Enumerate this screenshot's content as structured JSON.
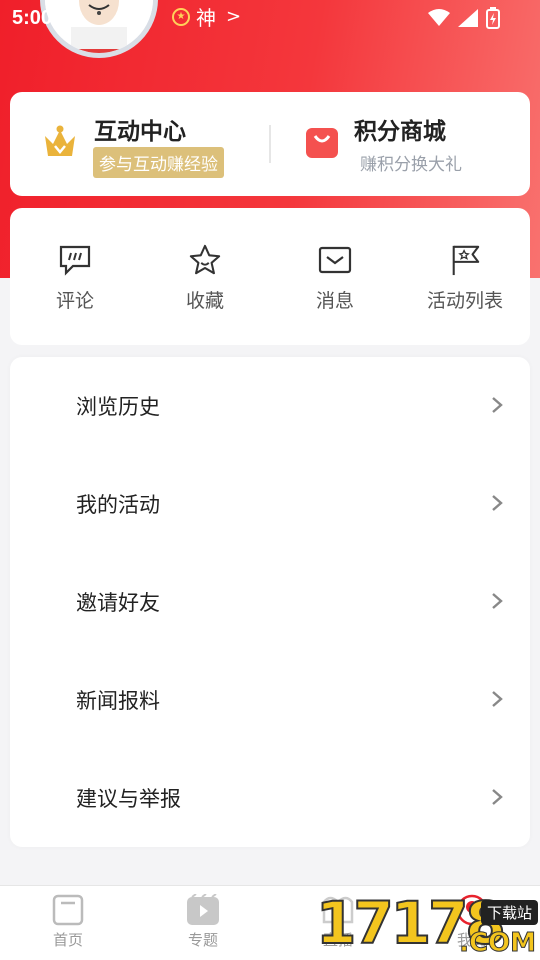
{
  "status_bar": {
    "time": "5:00"
  },
  "profile": {
    "level_label": "神"
  },
  "top_card": {
    "interaction": {
      "title": "互动中心",
      "badge": "参与互动赚经验"
    },
    "mall": {
      "title": "积分商城",
      "subtitle": "赚积分换大礼"
    }
  },
  "quick_actions": [
    {
      "label": "评论",
      "icon": "comment-icon"
    },
    {
      "label": "收藏",
      "icon": "star-icon"
    },
    {
      "label": "消息",
      "icon": "mail-icon"
    },
    {
      "label": "活动列表",
      "icon": "flag-icon"
    }
  ],
  "menu": [
    {
      "label": "浏览历史"
    },
    {
      "label": "我的活动"
    },
    {
      "label": "邀请好友"
    },
    {
      "label": "新闻报料"
    },
    {
      "label": "建议与举报"
    }
  ],
  "tabs": [
    {
      "label": "首页",
      "icon": "home-icon"
    },
    {
      "label": "专题",
      "icon": "video-icon"
    },
    {
      "label": "直播",
      "icon": "live-icon"
    },
    {
      "label": "我的",
      "icon": "profile-icon"
    }
  ],
  "watermark": {
    "number": "17178",
    "tag": "下载站",
    "suffix": ".COM"
  },
  "colors": {
    "brand_red": "#f01f2a",
    "gold": "#dcc07a"
  }
}
